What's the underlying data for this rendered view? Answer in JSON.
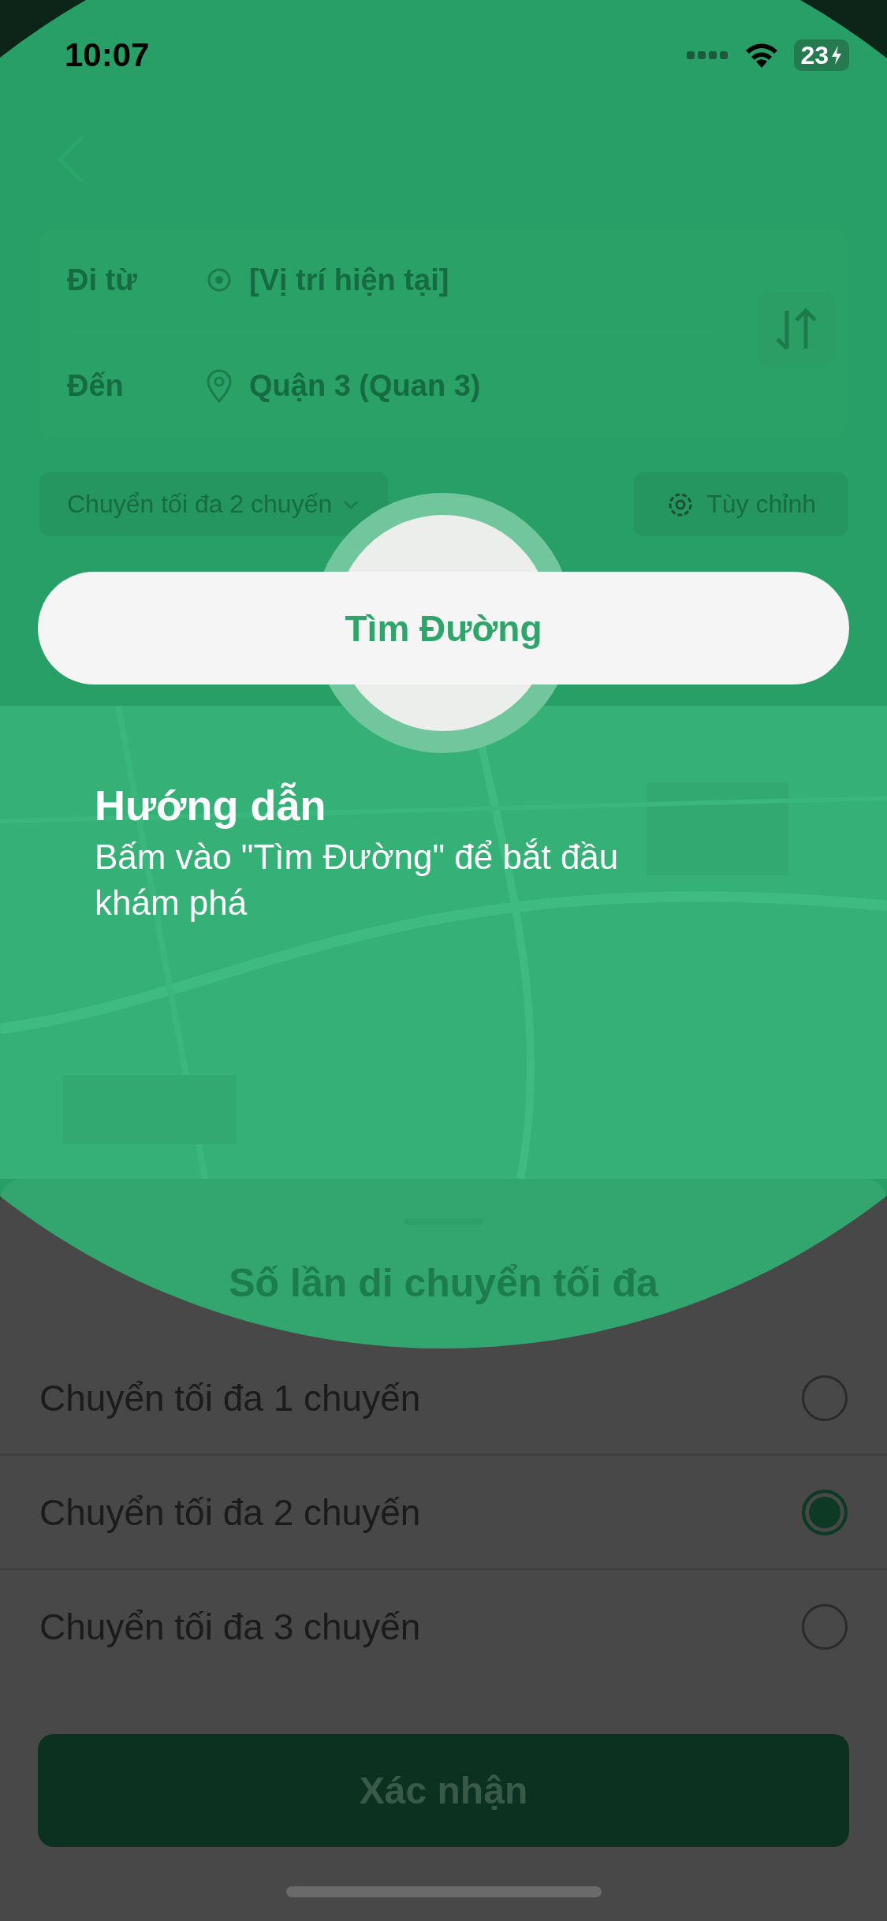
{
  "status_bar": {
    "time": "10:07",
    "battery": "23"
  },
  "route": {
    "from_label": "Đi từ",
    "from_value": "[Vị trí hiện tại]",
    "to_label": "Đến",
    "to_value": "Quận 3 (Quan 3)"
  },
  "options": {
    "transfer_dropdown": "Chuyển tối đa 2 chuyến",
    "customize": "Tùy chỉnh"
  },
  "find_button": "Tìm Đường",
  "guide": {
    "title": "Hướng dẫn",
    "text": "Bấm vào \"Tìm Đường\" để bắt đầu khám phá"
  },
  "sheet": {
    "title": "Số lần di chuyển tối đa",
    "choices": [
      {
        "label": "Chuyển tối đa 1 chuyến",
        "selected": false
      },
      {
        "label": "Chuyển tối đa 2 chuyến",
        "selected": true
      },
      {
        "label": "Chuyển tối đa 3 chuyến",
        "selected": false
      }
    ],
    "confirm": "Xác nhận"
  }
}
